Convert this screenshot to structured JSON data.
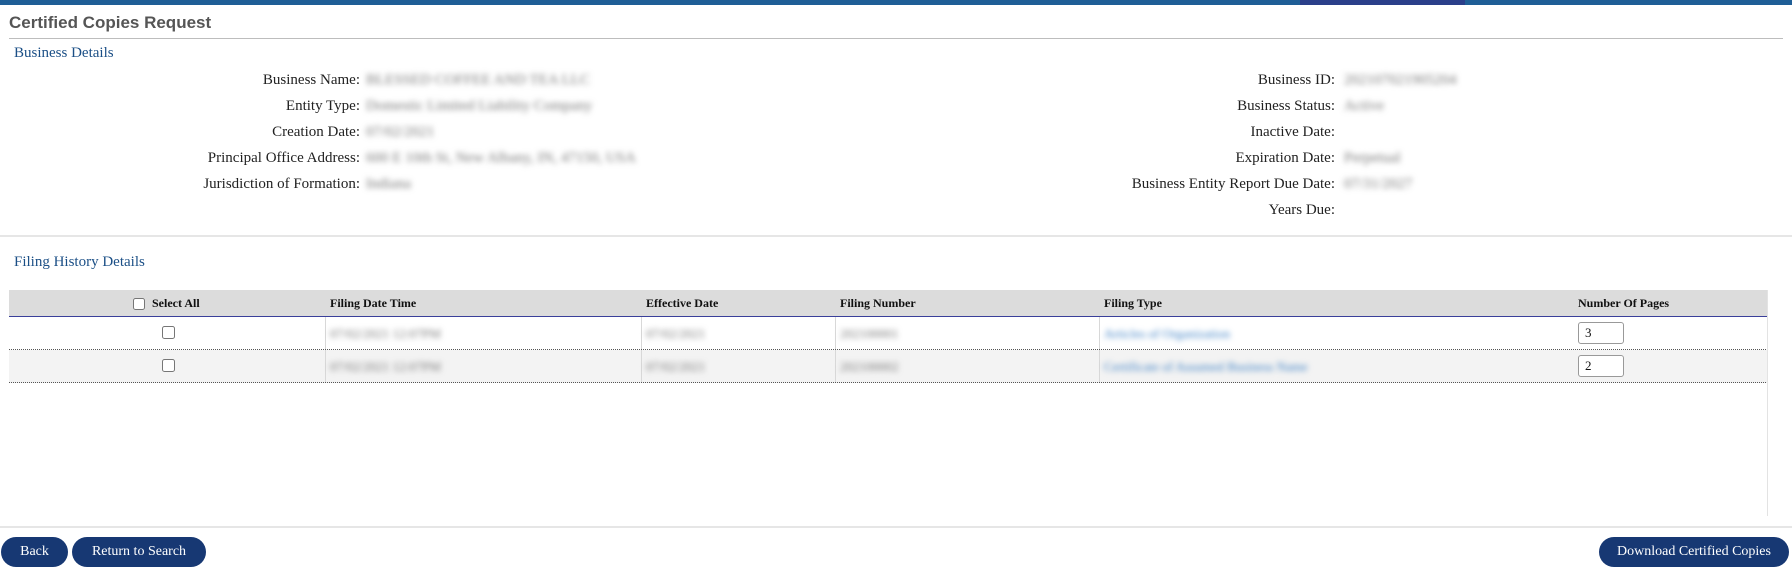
{
  "page": {
    "title": "Certified Copies Request"
  },
  "business_details": {
    "section_title": "Business Details",
    "left": [
      {
        "label": "Business Name:",
        "value": "BLESSED COFFEE AND TEA LLC"
      },
      {
        "label": "Entity Type:",
        "value": "Domestic Limited Liability Company"
      },
      {
        "label": "Creation Date:",
        "value": "07/02/2021"
      },
      {
        "label": "Principal Office Address:",
        "value": "600 E 10th St, New Albany, IN, 47150, USA"
      },
      {
        "label": "Jurisdiction of Formation:",
        "value": "Indiana"
      }
    ],
    "right": [
      {
        "label": "Business ID:",
        "value": "202107021905204"
      },
      {
        "label": "Business Status:",
        "value": "Active"
      },
      {
        "label": "Inactive Date:",
        "value": ""
      },
      {
        "label": "Expiration Date:",
        "value": "Perpetual"
      },
      {
        "label": "Business Entity Report Due Date:",
        "value": "07/31/2027"
      },
      {
        "label": "Years Due:",
        "value": ""
      }
    ]
  },
  "filing_history": {
    "section_title": "Filing History Details",
    "columns": {
      "select_all": "Select All",
      "filing_date_time": "Filing Date Time",
      "effective_date": "Effective Date",
      "filing_number": "Filing Number",
      "filing_type": "Filing Type",
      "number_of_pages": "Number Of Pages"
    },
    "rows": [
      {
        "filing_date_time": "07/02/2021 12:07PM",
        "effective_date": "07/02/2021",
        "filing_number": "202100001",
        "filing_type": "Articles of Organization",
        "number_of_pages": "3"
      },
      {
        "filing_date_time": "07/02/2021 12:07PM",
        "effective_date": "07/02/2021",
        "filing_number": "202100002",
        "filing_type": "Certificate of Assumed Business Name",
        "number_of_pages": "2"
      }
    ]
  },
  "buttons": {
    "back": "Back",
    "return_to_search": "Return to Search",
    "download": "Download Certified Copies"
  },
  "colors": {
    "accent": "#173873",
    "section_title": "#1b4f86",
    "link": "#3b7fc4",
    "top_bar": "#1f5e96"
  }
}
